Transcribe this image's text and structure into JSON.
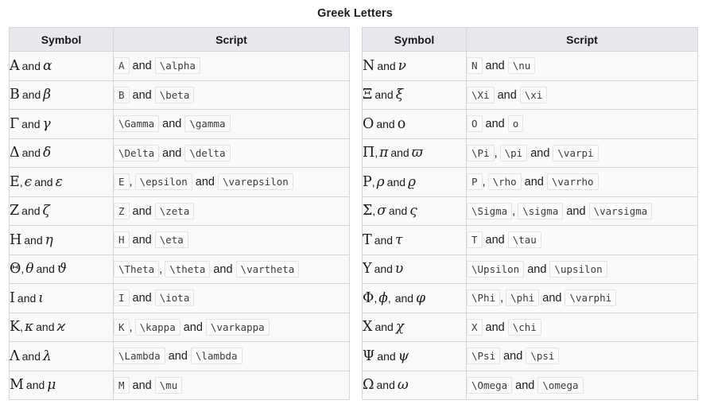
{
  "title": "Greek Letters",
  "columns": {
    "symbol": "Symbol",
    "script": "Script"
  },
  "separators": {
    "and": "and",
    "comma": ","
  },
  "tables": [
    {
      "id": "left",
      "rows": [
        {
          "symbol": [
            {
              "t": "upper",
              "v": "Α"
            },
            {
              "t": "and"
            },
            {
              "t": "lower",
              "v": "α"
            }
          ],
          "script": [
            {
              "t": "code",
              "v": "A"
            },
            {
              "t": "and"
            },
            {
              "t": "code",
              "v": "\\alpha"
            }
          ]
        },
        {
          "symbol": [
            {
              "t": "upper",
              "v": "Β"
            },
            {
              "t": "and"
            },
            {
              "t": "lower",
              "v": "β"
            }
          ],
          "script": [
            {
              "t": "code",
              "v": "B"
            },
            {
              "t": "and"
            },
            {
              "t": "code",
              "v": "\\beta"
            }
          ]
        },
        {
          "symbol": [
            {
              "t": "upper",
              "v": "Γ"
            },
            {
              "t": "and"
            },
            {
              "t": "lower",
              "v": "γ"
            }
          ],
          "script": [
            {
              "t": "code",
              "v": "\\Gamma"
            },
            {
              "t": "and"
            },
            {
              "t": "code",
              "v": "\\gamma"
            }
          ]
        },
        {
          "symbol": [
            {
              "t": "upper",
              "v": "Δ"
            },
            {
              "t": "and"
            },
            {
              "t": "lower",
              "v": "δ"
            }
          ],
          "script": [
            {
              "t": "code",
              "v": "\\Delta"
            },
            {
              "t": "and"
            },
            {
              "t": "code",
              "v": "\\delta"
            }
          ]
        },
        {
          "symbol": [
            {
              "t": "upper",
              "v": "Ε"
            },
            {
              "t": "comma"
            },
            {
              "t": "lower",
              "v": "ϵ"
            },
            {
              "t": "and"
            },
            {
              "t": "lower",
              "v": "ε"
            }
          ],
          "script": [
            {
              "t": "code",
              "v": "E"
            },
            {
              "t": "comma"
            },
            {
              "t": "code",
              "v": "\\epsilon"
            },
            {
              "t": "and"
            },
            {
              "t": "code",
              "v": "\\varepsilon"
            }
          ]
        },
        {
          "symbol": [
            {
              "t": "upper",
              "v": "Ζ"
            },
            {
              "t": "and"
            },
            {
              "t": "lower",
              "v": "ζ"
            }
          ],
          "script": [
            {
              "t": "code",
              "v": "Z"
            },
            {
              "t": "and"
            },
            {
              "t": "code",
              "v": "\\zeta"
            }
          ]
        },
        {
          "symbol": [
            {
              "t": "upper",
              "v": "Η"
            },
            {
              "t": "and"
            },
            {
              "t": "lower",
              "v": "η"
            }
          ],
          "script": [
            {
              "t": "code",
              "v": "H"
            },
            {
              "t": "and"
            },
            {
              "t": "code",
              "v": "\\eta"
            }
          ]
        },
        {
          "symbol": [
            {
              "t": "upper",
              "v": "Θ"
            },
            {
              "t": "comma"
            },
            {
              "t": "lower",
              "v": "θ"
            },
            {
              "t": "and"
            },
            {
              "t": "lower",
              "v": "ϑ"
            }
          ],
          "script": [
            {
              "t": "code",
              "v": "\\Theta"
            },
            {
              "t": "comma"
            },
            {
              "t": "code",
              "v": "\\theta"
            },
            {
              "t": "and"
            },
            {
              "t": "code",
              "v": "\\vartheta"
            }
          ]
        },
        {
          "symbol": [
            {
              "t": "upper",
              "v": "Ι"
            },
            {
              "t": "and"
            },
            {
              "t": "lower",
              "v": "ι"
            }
          ],
          "script": [
            {
              "t": "code",
              "v": "I"
            },
            {
              "t": "and"
            },
            {
              "t": "code",
              "v": "\\iota"
            }
          ]
        },
        {
          "symbol": [
            {
              "t": "upper",
              "v": "Κ"
            },
            {
              "t": "comma"
            },
            {
              "t": "lower",
              "v": "κ"
            },
            {
              "t": "and"
            },
            {
              "t": "lower",
              "v": "ϰ"
            }
          ],
          "script": [
            {
              "t": "code",
              "v": "K"
            },
            {
              "t": "comma"
            },
            {
              "t": "code",
              "v": "\\kappa"
            },
            {
              "t": "and"
            },
            {
              "t": "code",
              "v": "\\varkappa"
            }
          ]
        },
        {
          "symbol": [
            {
              "t": "upper",
              "v": "Λ"
            },
            {
              "t": "and"
            },
            {
              "t": "lower",
              "v": "λ"
            }
          ],
          "script": [
            {
              "t": "code",
              "v": "\\Lambda"
            },
            {
              "t": "and"
            },
            {
              "t": "code",
              "v": "\\lambda"
            }
          ]
        },
        {
          "symbol": [
            {
              "t": "upper",
              "v": "Μ"
            },
            {
              "t": "and"
            },
            {
              "t": "lower",
              "v": "μ"
            }
          ],
          "script": [
            {
              "t": "code",
              "v": "M"
            },
            {
              "t": "and"
            },
            {
              "t": "code",
              "v": "\\mu"
            }
          ]
        }
      ]
    },
    {
      "id": "right",
      "rows": [
        {
          "symbol": [
            {
              "t": "upper",
              "v": "Ν"
            },
            {
              "t": "and"
            },
            {
              "t": "lower",
              "v": "ν"
            }
          ],
          "script": [
            {
              "t": "code",
              "v": "N"
            },
            {
              "t": "and"
            },
            {
              "t": "code",
              "v": "\\nu"
            }
          ]
        },
        {
          "symbol": [
            {
              "t": "upper",
              "v": "Ξ"
            },
            {
              "t": "and"
            },
            {
              "t": "lower",
              "v": "ξ"
            }
          ],
          "script": [
            {
              "t": "code",
              "v": "\\Xi"
            },
            {
              "t": "and"
            },
            {
              "t": "code",
              "v": "\\xi"
            }
          ]
        },
        {
          "symbol": [
            {
              "t": "upper",
              "v": "Ο"
            },
            {
              "t": "and"
            },
            {
              "t": "lowerup",
              "v": "o"
            }
          ],
          "script": [
            {
              "t": "code",
              "v": "O"
            },
            {
              "t": "and"
            },
            {
              "t": "code",
              "v": "o"
            }
          ]
        },
        {
          "symbol": [
            {
              "t": "upper",
              "v": "Π"
            },
            {
              "t": "comma"
            },
            {
              "t": "lower",
              "v": "π"
            },
            {
              "t": "and"
            },
            {
              "t": "lower",
              "v": "ϖ"
            }
          ],
          "script": [
            {
              "t": "code",
              "v": "\\Pi"
            },
            {
              "t": "comma"
            },
            {
              "t": "code",
              "v": "\\pi"
            },
            {
              "t": "and"
            },
            {
              "t": "code",
              "v": "\\varpi"
            }
          ]
        },
        {
          "symbol": [
            {
              "t": "upper",
              "v": "Ρ"
            },
            {
              "t": "comma"
            },
            {
              "t": "lower",
              "v": "ρ"
            },
            {
              "t": "and"
            },
            {
              "t": "lower",
              "v": "ϱ"
            }
          ],
          "script": [
            {
              "t": "code",
              "v": "P"
            },
            {
              "t": "comma"
            },
            {
              "t": "code",
              "v": "\\rho"
            },
            {
              "t": "and"
            },
            {
              "t": "code",
              "v": "\\varrho"
            }
          ]
        },
        {
          "symbol": [
            {
              "t": "upper",
              "v": "Σ"
            },
            {
              "t": "comma"
            },
            {
              "t": "lower",
              "v": "σ"
            },
            {
              "t": "and"
            },
            {
              "t": "lower",
              "v": "ς"
            }
          ],
          "script": [
            {
              "t": "code",
              "v": "\\Sigma"
            },
            {
              "t": "comma"
            },
            {
              "t": "code",
              "v": "\\sigma"
            },
            {
              "t": "and"
            },
            {
              "t": "code",
              "v": "\\varsigma"
            }
          ]
        },
        {
          "symbol": [
            {
              "t": "upper",
              "v": "Τ"
            },
            {
              "t": "and"
            },
            {
              "t": "lower",
              "v": "τ"
            }
          ],
          "script": [
            {
              "t": "code",
              "v": "T"
            },
            {
              "t": "and"
            },
            {
              "t": "code",
              "v": "\\tau"
            }
          ]
        },
        {
          "symbol": [
            {
              "t": "upper",
              "v": "Υ"
            },
            {
              "t": "and"
            },
            {
              "t": "lower",
              "v": "υ"
            }
          ],
          "script": [
            {
              "t": "code",
              "v": "\\Upsilon"
            },
            {
              "t": "and"
            },
            {
              "t": "code",
              "v": "\\upsilon"
            }
          ]
        },
        {
          "symbol": [
            {
              "t": "upper",
              "v": "Φ"
            },
            {
              "t": "comma"
            },
            {
              "t": "lower",
              "v": "ϕ"
            },
            {
              "t": "comma"
            },
            {
              "t": "and"
            },
            {
              "t": "lower",
              "v": "φ"
            }
          ],
          "script": [
            {
              "t": "code",
              "v": "\\Phi"
            },
            {
              "t": "comma"
            },
            {
              "t": "code",
              "v": "\\phi"
            },
            {
              "t": "and"
            },
            {
              "t": "code",
              "v": "\\varphi"
            }
          ]
        },
        {
          "symbol": [
            {
              "t": "upper",
              "v": "Χ"
            },
            {
              "t": "and"
            },
            {
              "t": "lower",
              "v": "χ"
            }
          ],
          "script": [
            {
              "t": "code",
              "v": "X"
            },
            {
              "t": "and"
            },
            {
              "t": "code",
              "v": "\\chi"
            }
          ]
        },
        {
          "symbol": [
            {
              "t": "upper",
              "v": "Ψ"
            },
            {
              "t": "and"
            },
            {
              "t": "lower",
              "v": "ψ"
            }
          ],
          "script": [
            {
              "t": "code",
              "v": "\\Psi"
            },
            {
              "t": "and"
            },
            {
              "t": "code",
              "v": "\\psi"
            }
          ]
        },
        {
          "symbol": [
            {
              "t": "upper",
              "v": "Ω"
            },
            {
              "t": "and"
            },
            {
              "t": "lower",
              "v": "ω"
            }
          ],
          "script": [
            {
              "t": "code",
              "v": "\\Omega"
            },
            {
              "t": "and"
            },
            {
              "t": "code",
              "v": "\\omega"
            }
          ]
        }
      ]
    }
  ]
}
